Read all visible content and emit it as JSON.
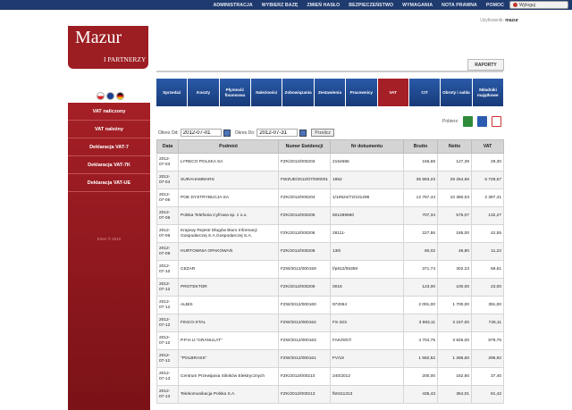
{
  "topnav": [
    "ADMINISTRACJA",
    "WYBIERZ BAZĘ",
    "ZMIEŃ HASŁO",
    "BEZPIECZEŃSTWO",
    "WYMAGANIA",
    "NOTA PRAWNA",
    "POMOC"
  ],
  "logout_label": "Wyloguj",
  "brand": {
    "name": "Mazur",
    "sub": "I PARTNERZY",
    "accent": "#a51f26",
    "nav_blue": "#1f3a6e"
  },
  "flags": [
    "PL",
    "EN",
    "DE"
  ],
  "sidebar_menu": [
    "VAT naliczony",
    "VAT należny",
    "Deklaracja VAT-7",
    "Deklaracja VAT-7K",
    "Deklaracja VAT-UE"
  ],
  "copyright": "Enter ® 2010",
  "user": {
    "label": "Użytkownik:",
    "name": "mazur"
  },
  "raporty_tab": "RAPORTY",
  "module_tabs": [
    "Sprzedaż",
    "Koszty",
    "Płynność finansowa",
    "Należności",
    "Zobowiązania",
    "Zestawienia",
    "Pracownicy",
    "VAT",
    "CIT",
    "Obroty i salda",
    "Składniki majątkowe"
  ],
  "active_tab": "VAT",
  "export_label": "Pobierz:",
  "filter": {
    "from_label": "Okres Od:",
    "from_value": "2012-07-01",
    "to_label": "Okres Do:",
    "to_value": "2012-07-31",
    "button": "Przelicz"
  },
  "table": {
    "headers": [
      "Data",
      "Podmiot",
      "Numer Ewidencji",
      "Nr dokumentu",
      "Brutto",
      "Netto",
      "VAT"
    ],
    "rows": [
      [
        "2012-07-03",
        "LYRECO POLSKA SA",
        "FZK/2012/000203",
        "2164686",
        "156,69",
        "127,39",
        "29,30"
      ],
      [
        "2012-07-04",
        "SURAHAMMARS",
        "FWZUE/2012/07/000001",
        "1852",
        "35 983,23",
        "29 254,66",
        "6 728,57"
      ],
      [
        "2012-07-06",
        "POE DYSTRYBUCJA SA",
        "FZK/2012/000204",
        "1/10524/72/101296",
        "12 767,44",
        "10 380,03",
        "2 387,41"
      ],
      [
        "2012-07-06",
        "Polska Telefonia Cyfrowa sp. z o.o.",
        "FZK/2012/000205",
        "501289690",
        "707,34",
        "575,07",
        "132,27"
      ],
      [
        "2012-07-06",
        "Krajowy Rejestr Długów Biuro Informacji Gospodarczej S.A.Gospodarczej S.A.",
        "FZK/2012/000206",
        "28111-",
        "227,55",
        "185,00",
        "42,55"
      ],
      [
        "2012-07-09",
        "HURTOWNIA OPAKOWAŃ",
        "FZK/2012/000208",
        "130i",
        "60,02",
        "48,80",
        "11,22"
      ],
      [
        "2012-07-10",
        "CEZAR",
        "FZW/2012/000159",
        "f/p812/06359",
        "371,74",
        "302,23",
        "69,51"
      ],
      [
        "2012-07-12",
        "PROTEKTOR",
        "FZK/2012/000209",
        "0016",
        "123,00",
        "100,00",
        "23,00"
      ],
      [
        "2012-07-12",
        "ALBIS",
        "FZW/2012/000160",
        "972064",
        "2 091,00",
        "1 700,00",
        "391,00"
      ],
      [
        "2012-07-12",
        "FINCO-STAL",
        "FZW/2012/000162",
        "FS-323",
        "3 883,11",
        "3 157,00",
        "726,11"
      ],
      [
        "2012-07-12",
        "P.P.H.U.\"GRANULAT\"",
        "FZW/2012/000163",
        "FAK/0/67/",
        "4 704,75",
        "3 825,00",
        "879,75"
      ],
      [
        "2012-07-12",
        "\"POLBRASS\"",
        "FZW/2012/000161",
        "FV/19",
        "1 582,52",
        "1 286,60",
        "295,92"
      ],
      [
        "2012-07-13",
        "Centrum Przewijania Silników Elektrycznych",
        "FZK/2012/000210",
        "240/2012",
        "200,00",
        "162,60",
        "37,40"
      ],
      [
        "2012-07-13",
        "Telekomunikacja Polska S.A.",
        "FZK/2012/000213",
        "fb0411313",
        "435,43",
        "354,01",
        "81,42"
      ]
    ]
  }
}
